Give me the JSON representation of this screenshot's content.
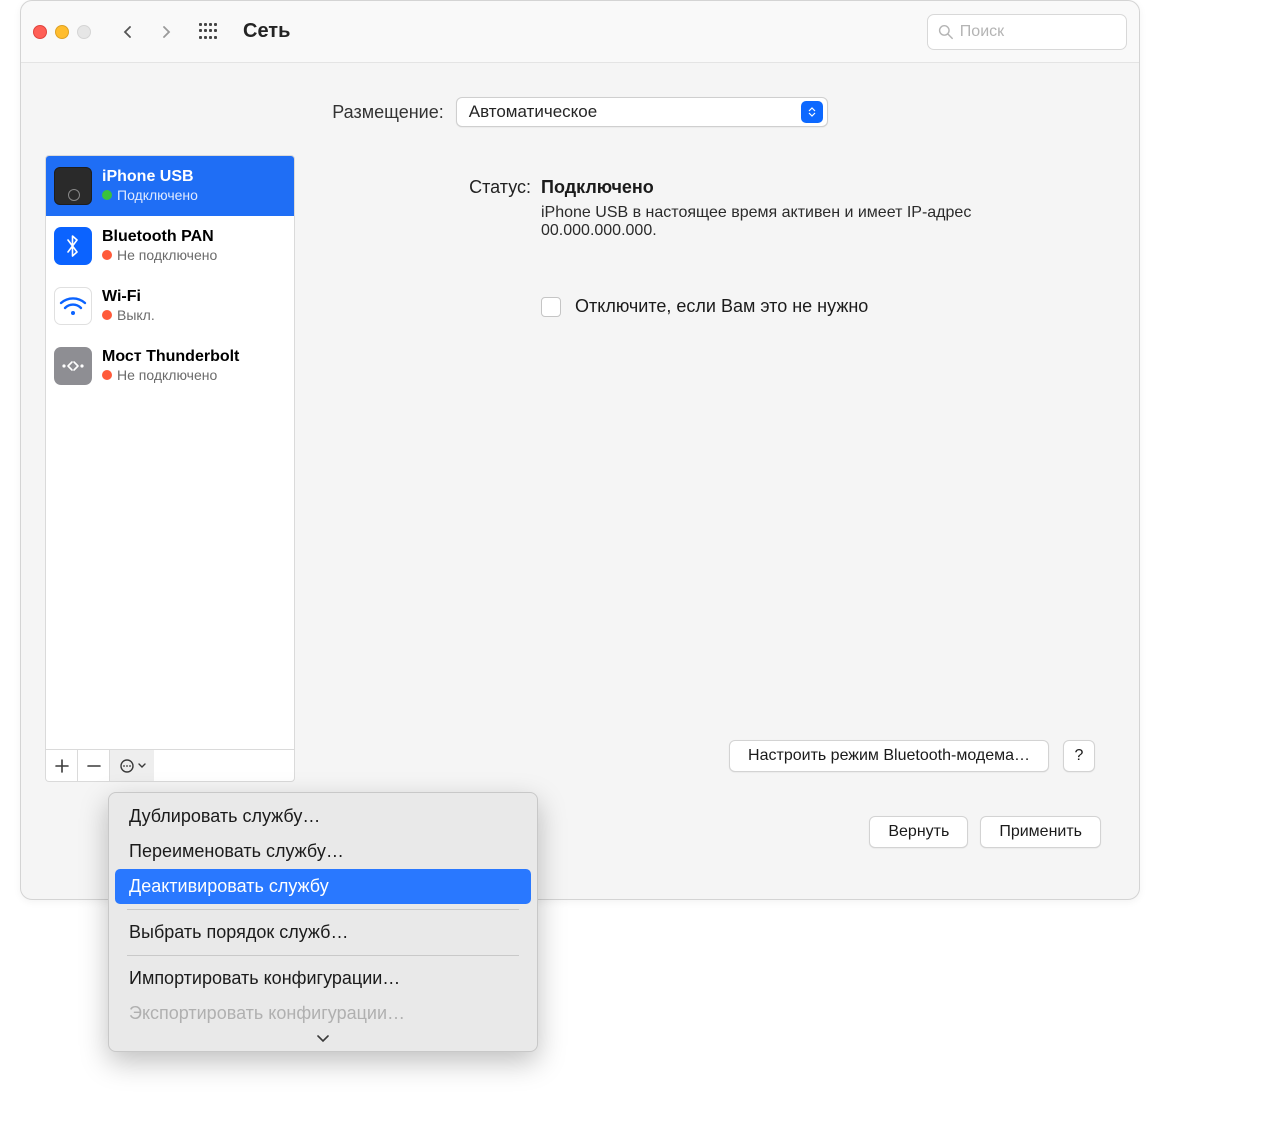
{
  "toolbar": {
    "title": "Сеть",
    "search_placeholder": "Поиск"
  },
  "location": {
    "label": "Размещение:",
    "value": "Автоматическое"
  },
  "services": [
    {
      "name": "iPhone USB",
      "status": "Подключено",
      "dot": "green"
    },
    {
      "name": "Bluetooth PAN",
      "status": "Не подключено",
      "dot": "red"
    },
    {
      "name": "Wi-Fi",
      "status": "Выкл.",
      "dot": "red"
    },
    {
      "name": "Мост Thunderbolt",
      "status": "Не подключено",
      "dot": "red"
    }
  ],
  "detail": {
    "status_label": "Статус:",
    "status_value": "Подключено",
    "status_desc": "iPhone USB в настоящее время активен и имеет IP-адрес 00.000.000.000.",
    "checkbox_label": "Отключите, если Вам это не нужно",
    "configure_button": "Настроить режим Bluetooth-модема…",
    "help": "?"
  },
  "footer": {
    "revert": "Вернуть",
    "apply": "Применить"
  },
  "menu": {
    "duplicate": "Дублировать службу…",
    "rename": "Переименовать службу…",
    "deactivate": "Деактивировать службу",
    "order": "Выбрать порядок служб…",
    "import": "Импортировать конфигурации…",
    "export": "Экспортировать конфигурации…"
  }
}
